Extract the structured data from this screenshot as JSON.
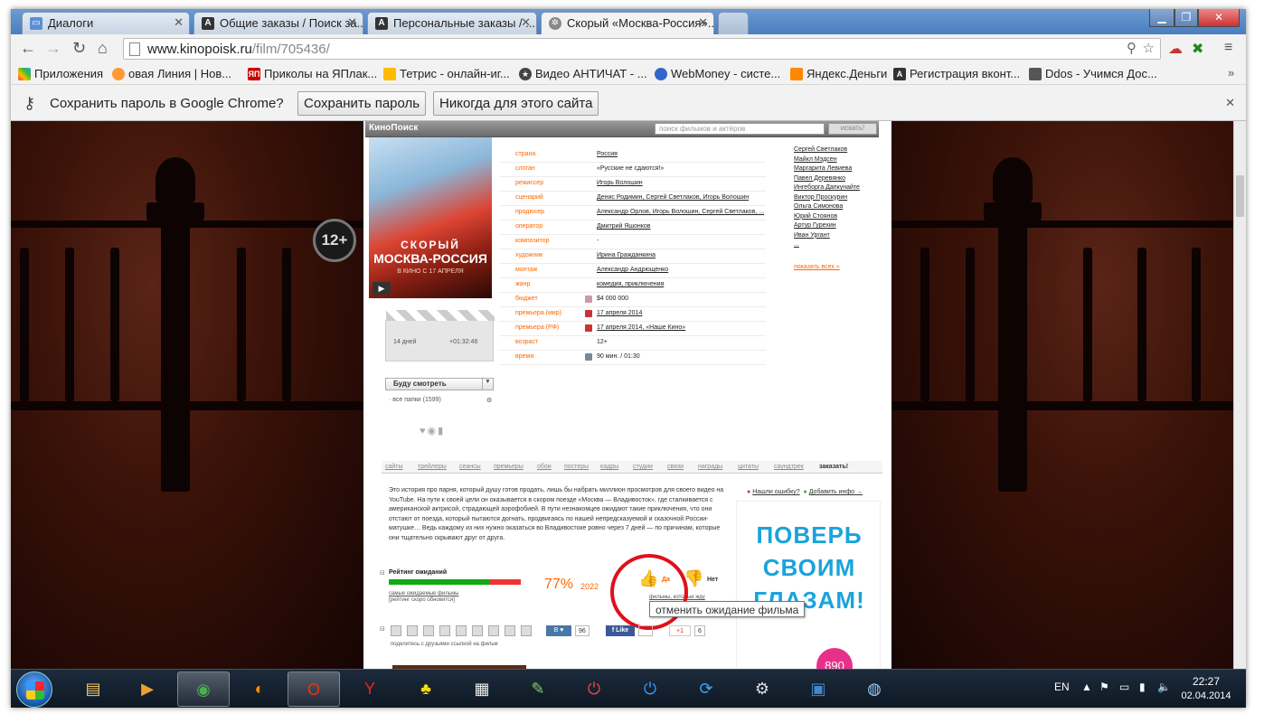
{
  "tabs": [
    {
      "title": "Диалоги",
      "icon": "chat"
    },
    {
      "title": "Общие заказы / Поиск за...",
      "icon": "A"
    },
    {
      "title": "Персональные заказы / ...",
      "icon": "A"
    },
    {
      "title": "Скорый «Москва-Россия»...",
      "icon": "film"
    }
  ],
  "url": {
    "host": "www.kinopoisk.ru",
    "path": "/film/705436/"
  },
  "bookmarks": [
    {
      "label": "Приложения",
      "color": "#e44"
    },
    {
      "label": "овая Линия | Нов...",
      "color": "#f93"
    },
    {
      "label": "Приколы на ЯПлак...",
      "color": "#c00"
    },
    {
      "label": "Тетрис - онлайн-иг...",
      "color": "#fb0"
    },
    {
      "label": "Видео АНТИЧАТ - ...",
      "color": "#444"
    },
    {
      "label": "WebMoney - систе...",
      "color": "#36c"
    },
    {
      "label": "Яндекс.Деньги",
      "color": "#f80"
    },
    {
      "label": "Регистрация вконт...",
      "color": "#333"
    },
    {
      "label": "Ddos - Учимся Дос...",
      "color": "#555"
    }
  ],
  "password_bar": {
    "question": "Сохранить пароль в Google Chrome?",
    "save": "Сохранить пароль",
    "never": "Никогда для этого сайта"
  },
  "kp_header": {
    "logo": "КиноПоиск",
    "search_placeholder": "поиск фильмов и актёров",
    "search_btn": "искать!"
  },
  "age_rating": "12+",
  "poster": {
    "line1": "СКОРЫЙ",
    "line2": "МОСКВА-РОССИЯ",
    "line3": "В КИНО С 17 АПРЕЛЯ"
  },
  "info_rows": [
    {
      "k": "страна",
      "v": "Россия"
    },
    {
      "k": "слоган",
      "v": "«Русские не сдаются!»"
    },
    {
      "k": "режиссер",
      "v": "Игорь Волошин"
    },
    {
      "k": "сценарий",
      "v": "Денис Родимин, Сергей Светлаков, Игорь Волошин"
    },
    {
      "k": "продюсер",
      "v": "Александр Орлов, Игорь Волошин, Сергей Светлаков, ..."
    },
    {
      "k": "оператор",
      "v": "Дмитрий Яшонков"
    },
    {
      "k": "композитор",
      "v": "-"
    },
    {
      "k": "художник",
      "v": "Ирина Гражданкина"
    },
    {
      "k": "монтаж",
      "v": "Александр Андрющенко"
    },
    {
      "k": "жанр",
      "v": "комедия, приключения"
    },
    {
      "k": "бюджет",
      "v": "$4 000 000"
    },
    {
      "k": "премьера (мир)",
      "v": "17 апреля 2014"
    },
    {
      "k": "премьера (РФ)",
      "v": "17 апреля 2014, «Наше Кино»"
    },
    {
      "k": "возраст",
      "v": "12+"
    },
    {
      "k": "время",
      "v": "90 мин. / 01:30"
    }
  ],
  "cast": [
    "Сергей Светлаков",
    "Майкл Мэдсен",
    "Маргарита Левиева",
    "Павел Деревянко",
    "Ингеборга Дапкунайте",
    "Виктор Проскурин",
    "Ольга Симонова",
    "Юрий Стоянов",
    "Артур Гурехин",
    "Иван Ургант",
    "..."
  ],
  "show_all": "показать всех »",
  "countdown": {
    "days": "14 дней",
    "time": "+01:32:46"
  },
  "watch_select": "Буду смотреть",
  "folders": {
    "label": "все папки (1599)"
  },
  "menu": [
    "сайты",
    "трейлеры",
    "сеансы",
    "премьеры",
    "обои",
    "постеры",
    "кадры",
    "студии",
    "связи",
    "награды",
    "цитаты",
    "саундтрек",
    "заказать!"
  ],
  "description": "Это история про парня, который душу готов продать, лишь бы набрать миллион просмотров для своего видео на YouTube. На пути к своей цели он оказывается в скором поезде «Москва — Владивосток», где сталкивается с американской актрисой, страдающей аэрофобией. В пути незнакомцев ожидают такие приключения, что они отстают от поезда, который пытаются догнать, продвигаясь по нашей непредсказуемой и сказочной России-матушке… Ведь каждому из них нужно оказаться во Владивостоке ровно через 7 дней — по причинам, которые они тщательно скрывают друг от друга.",
  "err_links": {
    "a": "Нашли ошибку?",
    "b": "Добавить инфо →"
  },
  "ad": {
    "l1": "ПОВЕРЬ",
    "l2": "СВОИМ",
    "l3": "ГЛАЗАМ!",
    "price": "890"
  },
  "rating": {
    "label": "Рейтинг ожиданий",
    "share": 0.77,
    "pct": "77%",
    "votes": "2022",
    "sub1": "самые ожидаемые фильмы",
    "sub2": "[рейтинг скоро обновится]",
    "yes": "Да",
    "no": "Нет",
    "sub3": "фильмы, которые жду"
  },
  "tooltip": "отменить ожидание фильма",
  "share": {
    "vk": "В",
    "vk_count": "96",
    "fb": "Like",
    "fb_count": "",
    "gp": "+1",
    "gp_count": "6",
    "text": "поделитесь с друзьями ссылкой на фильм"
  },
  "tray": {
    "lang": "EN",
    "time": "22:27",
    "date": "02.04.2014"
  }
}
